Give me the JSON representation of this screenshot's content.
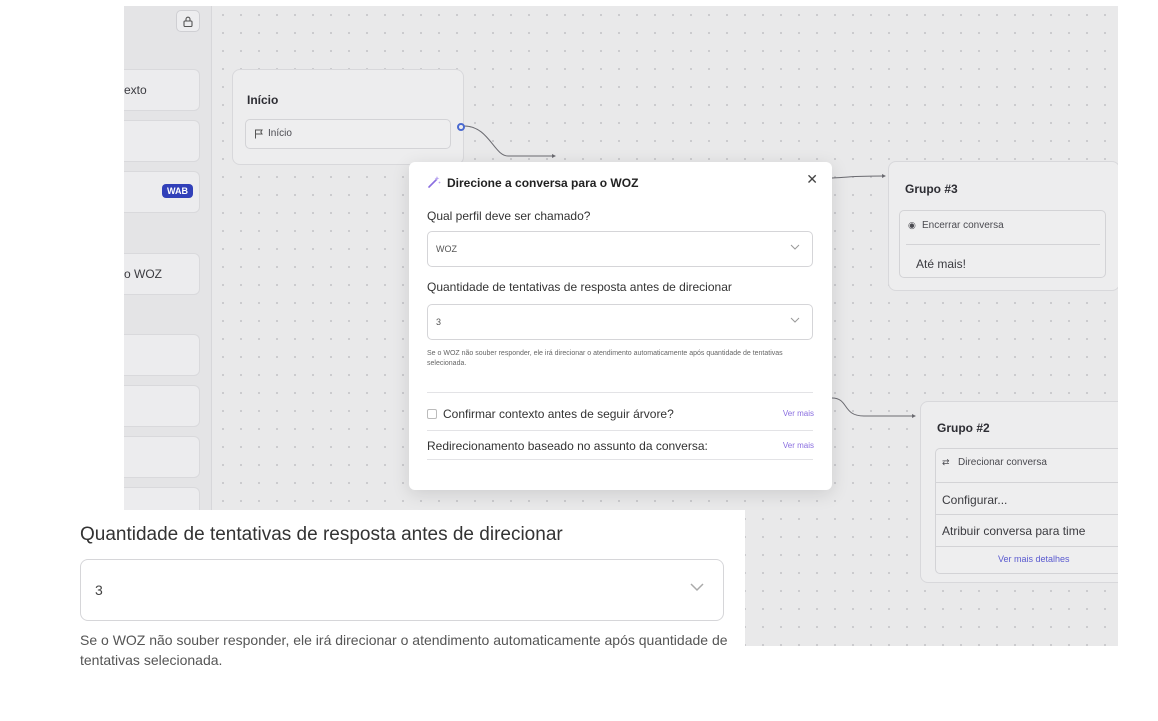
{
  "canvas": {
    "left_panel": {
      "items": [
        "exto",
        "",
        "",
        "o WOZ",
        "",
        "",
        ""
      ],
      "badge": "WAB"
    },
    "inicio_node": {
      "title": "Início",
      "row_label": "Início"
    },
    "group3": {
      "title": "Grupo #3",
      "row1": "Encerrar conversa",
      "row2": "Até mais!"
    },
    "group2": {
      "title": "Grupo #2",
      "row1": "Direcionar conversa",
      "row2": "Configurar...",
      "row3": "Atribuir conversa para time",
      "link": "Ver mais detalhes"
    }
  },
  "modal": {
    "title": "Direcione a conversa para o WOZ",
    "profile_label": "Qual perfil deve ser chamado?",
    "profile_value": "WOZ",
    "attempts_label": "Quantidade de tentativas de resposta antes de direcionar",
    "attempts_value": "3",
    "help_text": "Se o WOZ não souber responder, ele irá direcionar o atendimento automaticamente após quantidade de tentativas selecionada.",
    "confirm_label": "Confirmar contexto antes de seguir árvore?",
    "confirm_link": "Ver mais",
    "redirect_label": "Redirecionamento baseado no assunto da conversa:",
    "redirect_link": "Ver mais"
  },
  "zoom": {
    "label": "Quantidade de tentativas de resposta antes de direcionar",
    "value": "3",
    "help_text": "Se o WOZ não souber responder, ele irá direcionar o atendimento automaticamente após quantidade de tentativas selecionada."
  },
  "colors": {
    "accent": "#8a6ee0",
    "badge": "#3140b9",
    "node_port": "#4a6ad0"
  }
}
